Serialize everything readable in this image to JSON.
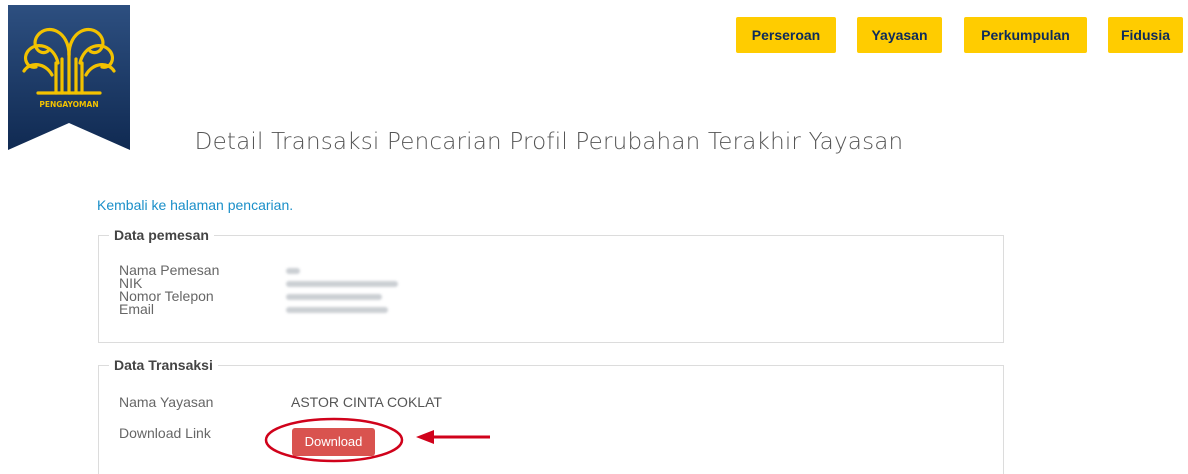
{
  "logo": {
    "text": "PENGAYOMAN"
  },
  "nav": {
    "items": [
      {
        "label": "Perseroan"
      },
      {
        "label": "Yayasan"
      },
      {
        "label": "Perkumpulan"
      },
      {
        "label": "Fidusia"
      }
    ]
  },
  "page": {
    "title": "Detail Transaksi Pencarian Profil Perubahan Terakhir Yayasan"
  },
  "back_link": {
    "label": "Kembali ke halaman pencarian."
  },
  "data_pemesan": {
    "legend": "Data pemesan",
    "rows": [
      {
        "label": "Nama Pemesan"
      },
      {
        "label": "NIK"
      },
      {
        "label": "Nomor Telepon"
      },
      {
        "label": "Email"
      }
    ]
  },
  "data_transaksi": {
    "legend": "Data Transaksi",
    "nama_yayasan_label": "Nama Yayasan",
    "nama_yayasan_value": "ASTOR CINTA COKLAT",
    "download_link_label": "Download Link",
    "download_button": "Download"
  },
  "colors": {
    "nav_bg": "#ffcc00",
    "nav_text": "#0d2b5c",
    "link": "#1a8fc9",
    "button": "#d9534f",
    "annotation": "#d0021b",
    "logo_bg": "#1b3a66",
    "logo_gold": "#f2c200"
  }
}
